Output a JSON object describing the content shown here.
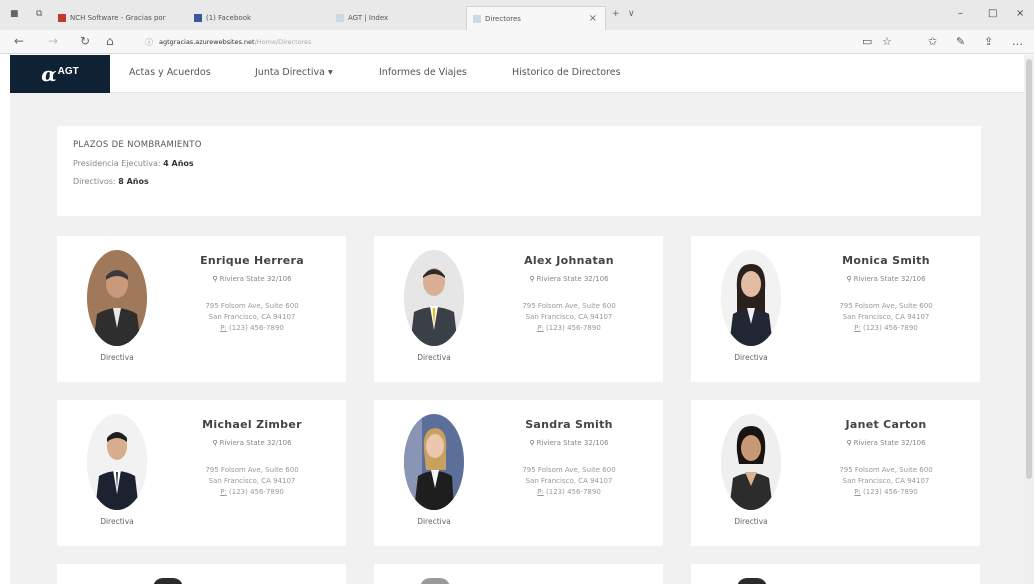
{
  "browser": {
    "tabs": [
      {
        "label": "NCH Software - Gracias por"
      },
      {
        "label": "(1) Facebook"
      },
      {
        "label": "AGT | Index"
      },
      {
        "label": "Directores"
      }
    ],
    "url_host": "agtgracias.azurewebsites.net",
    "url_path": "/Home/Directores"
  },
  "site": {
    "logo_alpha": "α",
    "logo_text": "AGT",
    "nav": {
      "actas": "Actas y Acuerdos",
      "junta": "Junta Directiva",
      "junta_caret": "▾",
      "informes": "Informes de Viajes",
      "historico": "Historico de Directores"
    }
  },
  "terms": {
    "heading": "PLAZOS DE NOMBRAMIENTO",
    "presidencia_label": "Presidencia Ejecutiva:",
    "presidencia_value": "4 Años",
    "directivos_label": "Directivos:",
    "directivos_value": "8 Años"
  },
  "directors": [
    {
      "name": "Enrique Herrera",
      "location": "Riviera State 32/106",
      "address1": "795 Folsom Ave, Suite 600",
      "address2": "San Francisco, CA 94107",
      "phone_prefix": "P:",
      "phone": "(123) 456-7890",
      "role": "Directiva"
    },
    {
      "name": "Alex Johnatan",
      "location": "Riviera State 32/106",
      "address1": "795 Folsom Ave, Suite 600",
      "address2": "San Francisco, CA 94107",
      "phone_prefix": "P:",
      "phone": "(123) 456-7890",
      "role": "Directiva"
    },
    {
      "name": "Monica Smith",
      "location": "Riviera State 32/106",
      "address1": "795 Folsom Ave, Suite 600",
      "address2": "San Francisco, CA 94107",
      "phone_prefix": "P:",
      "phone": "(123) 456-7890",
      "role": "Directiva"
    },
    {
      "name": "Michael Zimber",
      "location": "Riviera State 32/106",
      "address1": "795 Folsom Ave, Suite 600",
      "address2": "San Francisco, CA 94107",
      "phone_prefix": "P:",
      "phone": "(123) 456-7890",
      "role": "Directiva"
    },
    {
      "name": "Sandra Smith",
      "location": "Riviera State 32/106",
      "address1": "795 Folsom Ave, Suite 600",
      "address2": "San Francisco, CA 94107",
      "phone_prefix": "P:",
      "phone": "(123) 456-7890",
      "role": "Directiva"
    },
    {
      "name": "Janet Carton",
      "location": "Riviera State 32/106",
      "address1": "795 Folsom Ave, Suite 600",
      "address2": "San Francisco, CA 94107",
      "phone_prefix": "P:",
      "phone": "(123) 456-7890",
      "role": "Directiva"
    }
  ],
  "colors": {
    "brand_dark": "#0f2233",
    "page_bg": "#f1f1f1",
    "card_bg": "#ffffff"
  }
}
